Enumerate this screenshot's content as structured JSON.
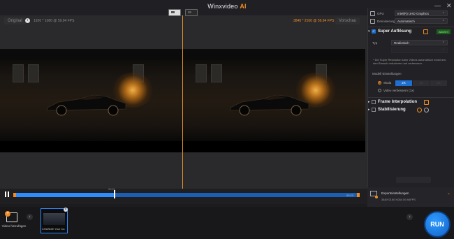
{
  "app": {
    "title": "Winxvideo",
    "title_ai": "AI",
    "minimize": "—",
    "close": "✕"
  },
  "viewer": {
    "original_label": "Original",
    "info_icon": "i",
    "left_info": "1920 * 1080 @ 59.94 FPS",
    "right_info": "3840 * 2160 @ 59.94 FPS",
    "preview_label": "Vorschau"
  },
  "timeline": {
    "current_time": "00:01",
    "end_time": "00:23",
    "progress": 0.29
  },
  "panel": {
    "gpu_label": "GPU",
    "gpu_value": "Intel(R) UHD Graphics",
    "denoise_label": "Denoiserung",
    "denoise_value": "Automatisch",
    "super_title": "Super Auflösung",
    "status_badge": "Aktiviert",
    "typ_label": "Typ",
    "typ_value": "Realistisch",
    "note": "* Die Super Resolution kann Videos automatisch erkennen, den Rausch reduzieren und verbessern.",
    "modell_label": "Modell Einstellungen",
    "scale_label": "Skala",
    "scale_options": [
      "2X",
      "3X",
      "4X"
    ],
    "video_enhance_label": "Video verbessern (1x)",
    "frame_interp_label": "Frame Interpolation",
    "stab_label": "Stabilisierung"
  },
  "export": {
    "title": "Exporteinstellungen",
    "info": "3840*2160  H264  59.94FPS"
  },
  "bottom": {
    "add_video": "Video hinzufügen",
    "clip_name": "CHANGE Your Ca",
    "run_label": "RUN"
  }
}
